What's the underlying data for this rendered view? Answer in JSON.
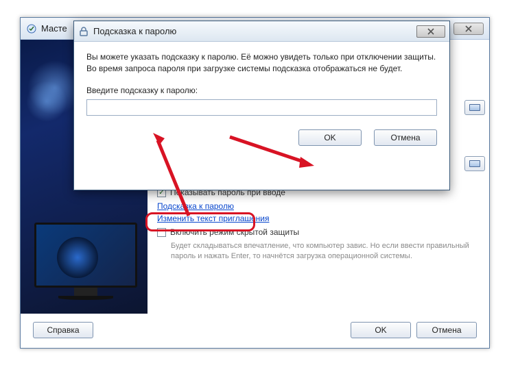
{
  "main": {
    "title": "Масте",
    "checkbox_show_password": "Показывать пароль при вводе",
    "link_hint": "Подсказка к паролю",
    "link_invite": "Изменить текст приглашения",
    "checkbox_stealth": "Включить режим скрытой защиты",
    "stealth_desc": "Будет складываться впечатление, что компьютер завис. Но если ввести правильный пароль и нажать Enter, то начнётся загрузка операционной системы.",
    "buttons": {
      "help": "Справка",
      "ok": "OK",
      "cancel": "Отмена"
    }
  },
  "modal": {
    "title": "Подсказка к паролю",
    "description": "Вы можете указать подсказку к паролю. Её можно увидеть только при отключении защиты. Во время запроса пароля при загрузке системы подсказка отображаться не будет.",
    "input_label": "Введите подсказку к паролю:",
    "input_value": "",
    "buttons": {
      "ok": "OK",
      "cancel": "Отмена"
    }
  }
}
